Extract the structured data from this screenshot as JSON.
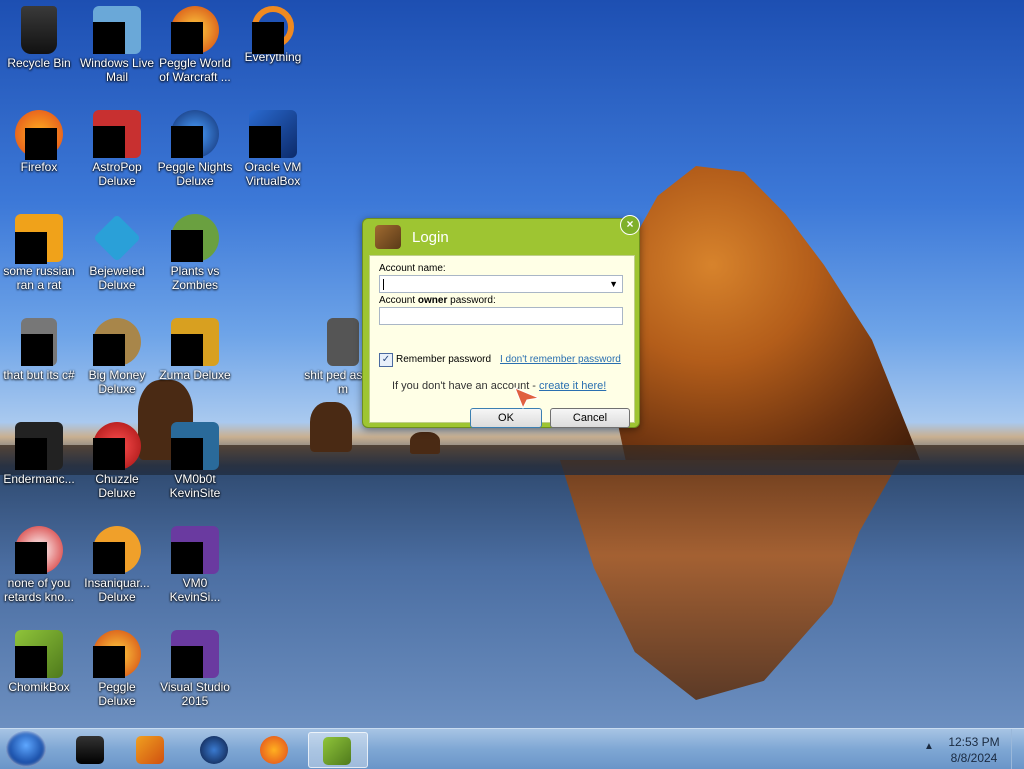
{
  "desktop": {
    "icons": [
      {
        "label": "Recycle Bin"
      },
      {
        "label": "Windows Live Mail"
      },
      {
        "label": "Peggle World of Warcraft ..."
      },
      {
        "label": "Everything"
      },
      {
        "label": "Firefox"
      },
      {
        "label": "AstroPop Deluxe"
      },
      {
        "label": "Peggle Nights Deluxe"
      },
      {
        "label": "Oracle VM VirtualBox"
      },
      {
        "label": "some russian ran a rat"
      },
      {
        "label": "Bejeweled Deluxe"
      },
      {
        "label": "Plants vs Zombies"
      },
      {
        "label": "that but its c#"
      },
      {
        "label": "Big Money Deluxe"
      },
      {
        "label": "Zuma Deluxe"
      },
      {
        "label": "shit ped asked m"
      },
      {
        "label": "Endermanc..."
      },
      {
        "label": "Chuzzle Deluxe"
      },
      {
        "label": "VM0b0t KevinSite"
      },
      {
        "label": "none of you retards kno..."
      },
      {
        "label": "Insaniquar... Deluxe"
      },
      {
        "label": "VM0 KevinSi..."
      },
      {
        "label": "ChomikBox"
      },
      {
        "label": "Peggle Deluxe"
      },
      {
        "label": "Visual Studio 2015"
      }
    ]
  },
  "login": {
    "title": "Login",
    "account_name_label": "Account name:",
    "account_name_value": "",
    "password_label_pre": "Account ",
    "password_label_bold": "owner",
    "password_label_post": " password:",
    "password_value": "",
    "remember_label": "Remember password",
    "remember_checked": true,
    "forgot_link": "I don't remember password",
    "no_account_text": "If you don't have an account - ",
    "create_link": "create it here!",
    "ok_label": "OK",
    "cancel_label": "Cancel",
    "close_symbol": "×"
  },
  "taskbar": {
    "items": [
      "start",
      "media-center",
      "windows-media-player",
      "globe",
      "firefox",
      "chomikbox"
    ],
    "active_item": "chomikbox",
    "tray_arrow": "▲",
    "time": "12:53 PM",
    "date": "8/8/2024"
  },
  "colors": {
    "dialog_green": "#9ec532",
    "panel_bg": "#ffffe6",
    "link": "#2a6fb0"
  }
}
